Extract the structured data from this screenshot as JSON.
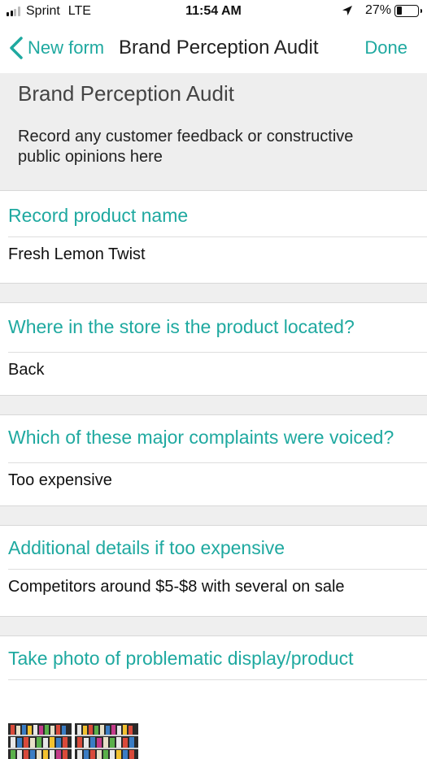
{
  "status_bar": {
    "carrier": "Sprint",
    "network": "LTE",
    "time": "11:54 AM",
    "battery_percent": "27%",
    "battery_level": 0.27,
    "icons": [
      "signal-bars-icon",
      "location-arrow-icon",
      "battery-icon"
    ]
  },
  "nav": {
    "back_label": "New form",
    "title": "Brand Perception Audit",
    "done_label": "Done",
    "back_icon": "chevron-left-icon"
  },
  "header": {
    "title": "Brand Perception Audit",
    "description": "Record any customer feedback or constructive public opinions here"
  },
  "questions": [
    {
      "label": "Record product name",
      "value": "Fresh Lemon Twist"
    },
    {
      "label": "Where in the store is the product located?",
      "value": "Back"
    },
    {
      "label": "Which of these major complaints were voiced?",
      "value": "Too expensive"
    },
    {
      "label": "Additional details if too expensive",
      "value": "Competitors around $5-$8  with several on sale"
    },
    {
      "label": "Take photo of problematic display/product",
      "value": ""
    }
  ],
  "colors": {
    "accent": "#1fa9a0",
    "gray_bg": "#eeeeee",
    "text": "#111111"
  }
}
